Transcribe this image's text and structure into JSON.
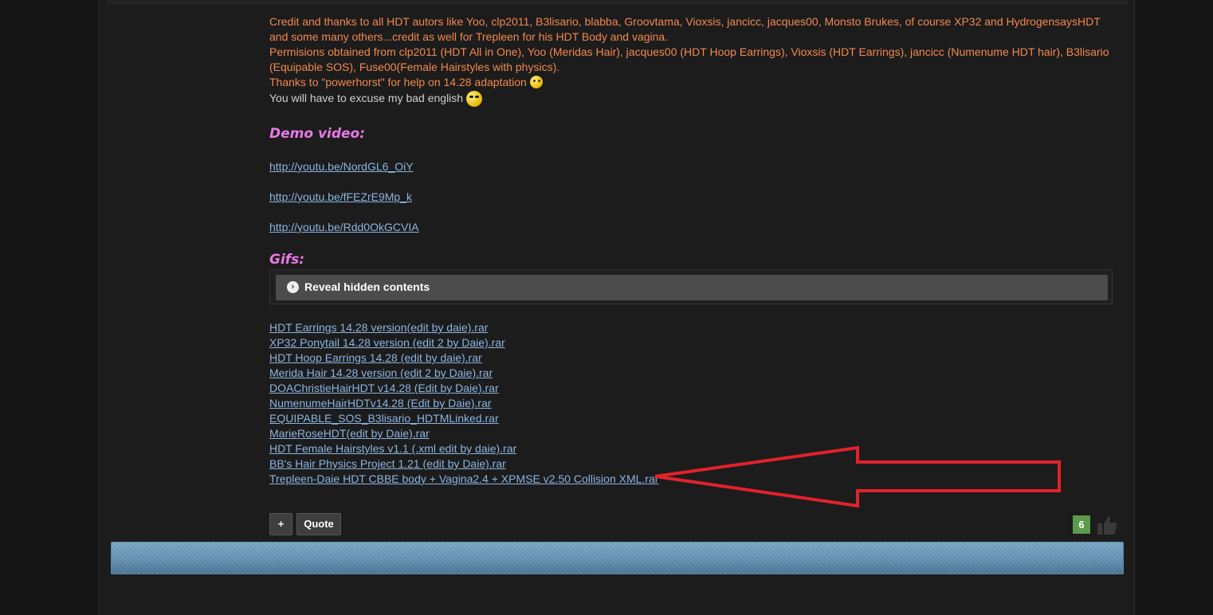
{
  "post": {
    "credits_line1": "Credit and thanks to all HDT autors like Yoo, clp2011, B3lisario, blabba, Groovtama, Vioxsis, jancicc, jacques00, Monsto Brukes, of course XP32 and HydrogensaysHDT",
    "credits_line2": "and some many others...credit as well for Trepleen for his HDT Body and vagina.",
    "permissions_line1": "Permisions obtained from clp2011 (HDT All in One), Yoo (Meridas Hair), jacques00 (HDT Hoop Earrings), Vioxsis (HDT Earrings), jancicc (Numenume HDT hair), B3lisario",
    "permissions_line2": "(Equipable SOS), Fuse00(Female Hairstyles with physics).",
    "thanks_line": "Thanks to \"powerhorst\" for help on 14.28 adaptation",
    "excuse_line": "You will have to excuse my bad english",
    "demo_heading": "Demo video:",
    "videos": [
      "http://youtu.be/NordGL6_OiY",
      "http://youtu.be/fFEZrE9Mp_k",
      "http://youtu.be/Rdd0OkGCVIA"
    ],
    "gifs_heading": "Gifs:",
    "spoiler_label": "Reveal hidden contents",
    "spoiler_icon": "chevron-right-circle-icon",
    "files": [
      "HDT Earrings 14.28 version(edit by daie).rar",
      "XP32 Ponytail 14.28 version (edit 2 by Daie).rar",
      "HDT Hoop Earrings 14.28 (edit by daie).rar",
      "Merida Hair 14.28 version (edit 2 by Daie).rar",
      "DOAChristieHairHDT v14.28 (Edit by Daie).rar",
      "NumenumeHairHDTv14.28 (Edit by Daie).rar",
      "EQUIPABLE_SOS_B3lisario_HDTMLinked.rar",
      "MarieRoseHDT(edit by Daie).rar",
      "HDT Female Hairstyles v1.1 (.xml edit by daie).rar",
      "BB's Hair Physics Project 1.21 (edit by Daie).rar",
      "Trepleen-Daie HDT CBBE body + Vagina2.4 + XPMSE v2.50 Collision XML.rar"
    ]
  },
  "actions": {
    "plus_label": "+",
    "quote_label": "Quote",
    "like_count": "6",
    "like_icon": "thumbs-up-icon"
  },
  "colors": {
    "credits_text": "#f2884f",
    "link": "#8ab4e0",
    "heading": "#e879e8",
    "annotation_arrow": "#e3222b",
    "like_badge": "#5c9a4c"
  }
}
